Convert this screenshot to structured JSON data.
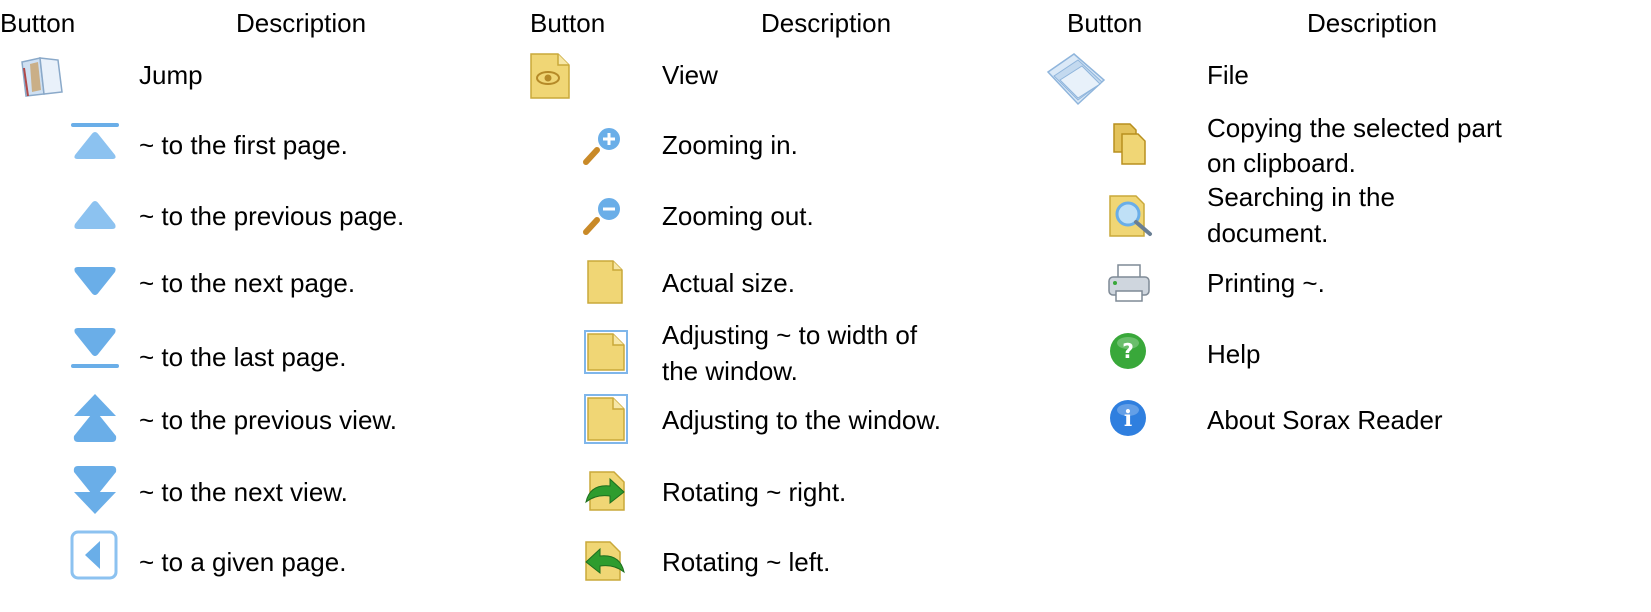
{
  "headers": {
    "c1_button": "Button",
    "c1_desc": "Description",
    "c2_button": "Button",
    "c2_desc": "Description",
    "c3_button": "Button",
    "c3_desc": "Description"
  },
  "jump": {
    "title": "Jump",
    "rows": [
      {
        "icon": "first-page-icon",
        "label": "~ to the first page."
      },
      {
        "icon": "previous-page-icon",
        "label": "~ to the previous page."
      },
      {
        "icon": "next-page-icon",
        "label": "~ to the next page."
      },
      {
        "icon": "last-page-icon",
        "label": "~ to the last page."
      },
      {
        "icon": "previous-view-icon",
        "label": "~ to the previous view."
      },
      {
        "icon": "next-view-icon",
        "label": "~ to the next view."
      },
      {
        "icon": "go-to-page-icon",
        "label": "~ to a given page."
      }
    ]
  },
  "view": {
    "title": "View",
    "rows": [
      {
        "icon": "zoom-in-icon",
        "label": "Zooming in."
      },
      {
        "icon": "zoom-out-icon",
        "label": "Zooming out."
      },
      {
        "icon": "actual-size-icon",
        "label": "Actual size."
      },
      {
        "icon": "fit-width-icon",
        "line1": "Adjusting ~ to width of",
        "line2": "the window."
      },
      {
        "icon": "fit-window-icon",
        "label": "Adjusting to the window."
      },
      {
        "icon": "rotate-right-icon",
        "label": "Rotating ~ right."
      },
      {
        "icon": "rotate-left-icon",
        "label": "Rotating ~ left."
      }
    ]
  },
  "file": {
    "title": "File",
    "rows": [
      {
        "icon": "copy-icon",
        "line1": "Copying the selected part",
        "line2": "on clipboard."
      },
      {
        "icon": "search-icon",
        "line1": "Searching in the",
        "line2": "document."
      },
      {
        "icon": "print-icon",
        "label": "Printing ~."
      },
      {
        "icon": "help-icon",
        "label": "Help",
        "glyph": "?"
      },
      {
        "icon": "about-icon",
        "label": "About Sorax Reader",
        "glyph": "i"
      }
    ]
  },
  "colors": {
    "arrow_blue": "#6aaee8",
    "page_yellow": "#f0d675",
    "help_green": "#39a83a",
    "info_blue": "#2f7fdf"
  }
}
